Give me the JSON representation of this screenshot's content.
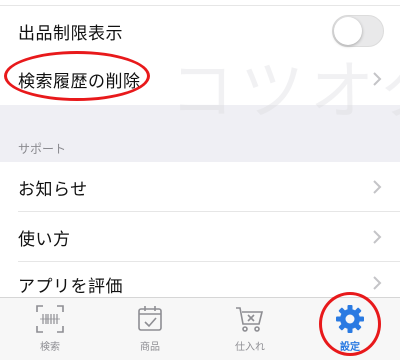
{
  "settings": {
    "items": [
      {
        "label": "出品制限表示",
        "control": "toggle",
        "value": false
      },
      {
        "label": "検索履歴の削除",
        "control": "chevron"
      }
    ],
    "watermark": "コツオク"
  },
  "support": {
    "header": "サポート",
    "items": [
      {
        "label": "お知らせ"
      },
      {
        "label": "使い方"
      },
      {
        "label": "アプリを評価"
      }
    ]
  },
  "tabbar": {
    "tabs": [
      {
        "label": "検索",
        "icon": "barcode-scan-icon"
      },
      {
        "label": "商品",
        "icon": "calendar-check-icon"
      },
      {
        "label": "仕入れ",
        "icon": "cart-x-icon"
      },
      {
        "label": "設定",
        "icon": "gear-icon",
        "active": true
      }
    ]
  },
  "colors": {
    "accent": "#2a7ae2",
    "annotation": "#e8191b",
    "section_bg": "#efeff4"
  }
}
